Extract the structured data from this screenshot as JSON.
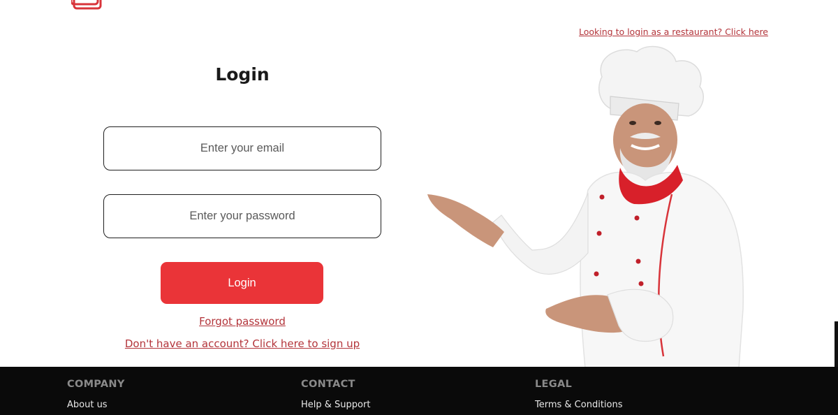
{
  "header": {
    "restaurant_login_link": "Looking to login as a restaurant? Click here"
  },
  "login": {
    "title": "Login",
    "email_placeholder": "Enter your email",
    "password_placeholder": "Enter your password",
    "button_label": "Login",
    "forgot_password": "Forgot password",
    "signup_link": "Don't have an account? Click here to sign up"
  },
  "footer": {
    "columns": [
      {
        "heading": "COMPANY",
        "link": "About us"
      },
      {
        "heading": "CONTACT",
        "link": "Help & Support"
      },
      {
        "heading": "LEGAL",
        "link": "Terms & Conditions"
      }
    ]
  },
  "colors": {
    "accent": "#ea3438",
    "link": "#b3343a",
    "footer_bg": "#0a0a0a"
  }
}
